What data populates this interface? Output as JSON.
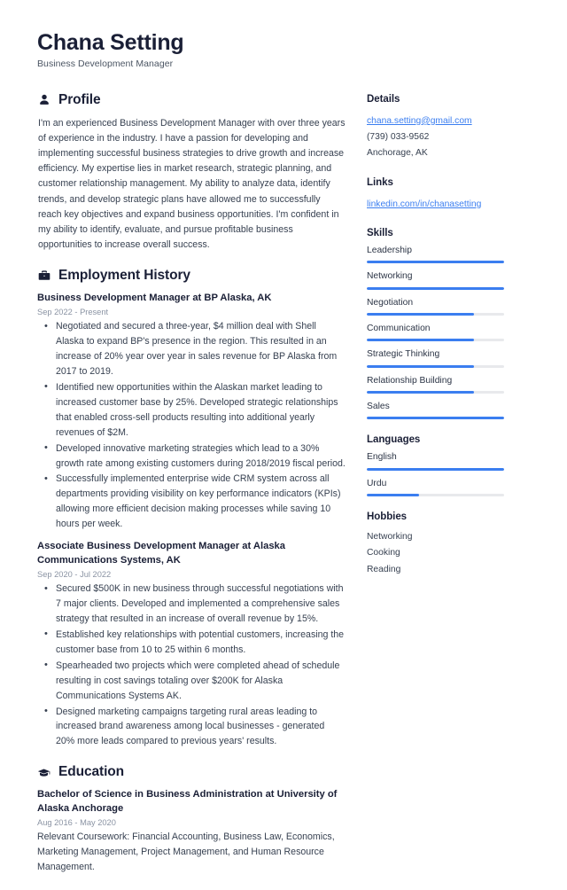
{
  "header": {
    "name": "Chana Setting",
    "title": "Business Development Manager"
  },
  "sections": {
    "profile": {
      "heading": "Profile",
      "icon": "person-icon",
      "text": "I'm an experienced Business Development Manager with over three years of experience in the industry. I have a passion for developing and implementing successful business strategies to drive growth and increase efficiency. My expertise lies in market research, strategic planning, and customer relationship management. My ability to analyze data, identify trends, and develop strategic plans have allowed me to successfully reach key objectives and expand business opportunities. I'm confident in my ability to identify, evaluate, and pursue profitable business opportunities to increase overall success."
    },
    "employment": {
      "heading": "Employment History",
      "icon": "briefcase-icon",
      "entries": [
        {
          "title": "Business Development Manager at BP Alaska, AK",
          "date": "Sep 2022 - Present",
          "bullets": [
            "Negotiated and secured a three-year, $4 million deal with Shell Alaska to expand BP's presence in the region. This resulted in an increase of 20% year over year in sales revenue for BP Alaska from 2017 to 2019.",
            "Identified new opportunities within the Alaskan market leading to increased customer base by 25%. Developed strategic relationships that enabled cross-sell products resulting into additional yearly revenues of $2M.",
            "Developed innovative marketing strategies which lead to a 30% growth rate among existing customers during 2018/2019 fiscal period.",
            "Successfully implemented enterprise wide CRM system across all departments providing visibility on key performance indicators (KPIs) allowing more efficient decision making processes while saving 10 hours per week."
          ]
        },
        {
          "title": "Associate Business Development Manager at Alaska Communications Systems, AK",
          "date": "Sep 2020 - Jul 2022",
          "bullets": [
            "Secured $500K in new business through successful negotiations with 7 major clients. Developed and implemented a comprehensive sales strategy that resulted in an increase of overall revenue by 15%.",
            "Established key relationships with potential customers, increasing the customer base from 10 to 25 within 6 months.",
            "Spearheaded two projects which were completed ahead of schedule resulting in cost savings totaling over $200K for Alaska Communications Systems AK.",
            "Designed marketing campaigns targeting rural areas leading to increased brand awareness among local businesses - generated 20% more leads compared to previous years' results."
          ]
        }
      ]
    },
    "education": {
      "heading": "Education",
      "icon": "graduation-cap-icon",
      "entries": [
        {
          "title": "Bachelor of Science in Business Administration at University of Alaska Anchorage",
          "date": "Aug 2016 - May 2020",
          "description": "Relevant Coursework: Financial Accounting, Business Law, Economics, Marketing Management, Project Management, and Human Resource Management."
        }
      ]
    }
  },
  "sidebar": {
    "details": {
      "heading": "Details",
      "email": "chana.setting@gmail.com",
      "phone": "(739) 033-9562",
      "location": "Anchorage, AK"
    },
    "links": {
      "heading": "Links",
      "items": [
        {
          "label": "linkedin.com/in/chanasetting"
        }
      ]
    },
    "skills": {
      "heading": "Skills",
      "items": [
        {
          "label": "Leadership",
          "level": 100
        },
        {
          "label": "Networking",
          "level": 100
        },
        {
          "label": "Negotiation",
          "level": 78
        },
        {
          "label": "Communication",
          "level": 78
        },
        {
          "label": "Strategic Thinking",
          "level": 78
        },
        {
          "label": "Relationship Building",
          "level": 78
        },
        {
          "label": "Sales",
          "level": 100
        }
      ]
    },
    "languages": {
      "heading": "Languages",
      "items": [
        {
          "label": "English",
          "level": 100
        },
        {
          "label": "Urdu",
          "level": 38
        }
      ]
    },
    "hobbies": {
      "heading": "Hobbies",
      "items": [
        {
          "label": "Networking"
        },
        {
          "label": "Cooking"
        },
        {
          "label": "Reading"
        }
      ]
    }
  },
  "theme": {
    "accent": "#3b7ef0",
    "track": "#e8e9ec",
    "heading": "#1a1f36",
    "body": "#374151",
    "muted": "#8a93a3"
  }
}
